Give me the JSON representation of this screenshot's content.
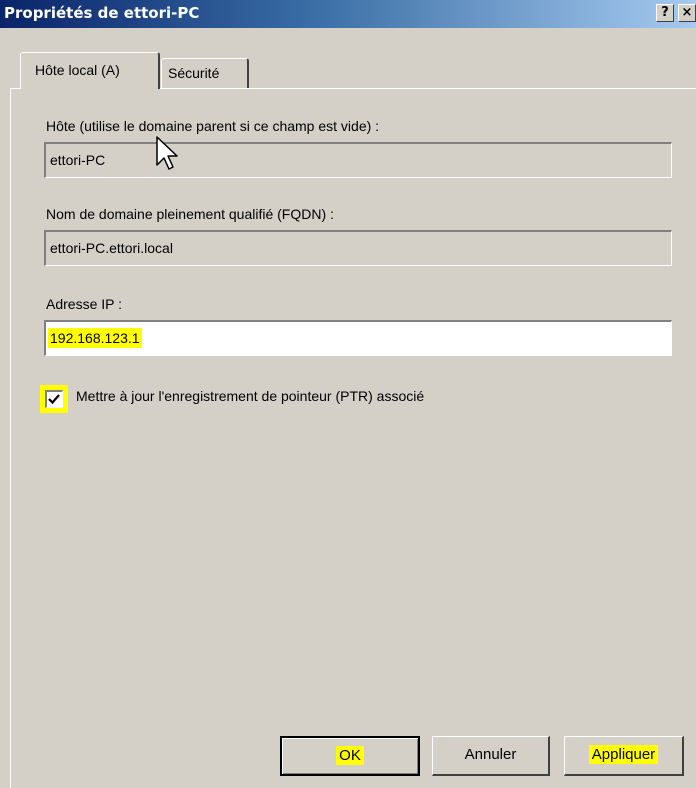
{
  "window": {
    "title": "Propriétés de ettori-PC",
    "help_label": "?",
    "close_label": "×"
  },
  "tabs": [
    {
      "label": "Hôte local (A)",
      "active": true
    },
    {
      "label": "Sécurité",
      "active": false
    }
  ],
  "form": {
    "host_label": "Hôte (utilise le domaine parent si ce champ est vide) :",
    "host_value": "ettori-PC",
    "fqdn_label": "Nom de domaine pleinement qualifié (FQDN) :",
    "fqdn_value": "ettori-PC.ettori.local",
    "ip_label": "Adresse IP :",
    "ip_value": "192.168.123.1",
    "ptr_label": "Mettre à jour l'enregistrement de pointeur (PTR) associé",
    "ptr_checked": true
  },
  "buttons": {
    "ok": "OK",
    "cancel": "Annuler",
    "apply": "Appliquer"
  },
  "colors": {
    "highlight": "#ffff00",
    "dialog_bg": "#d4d0c8",
    "title_start": "#0a246a"
  }
}
